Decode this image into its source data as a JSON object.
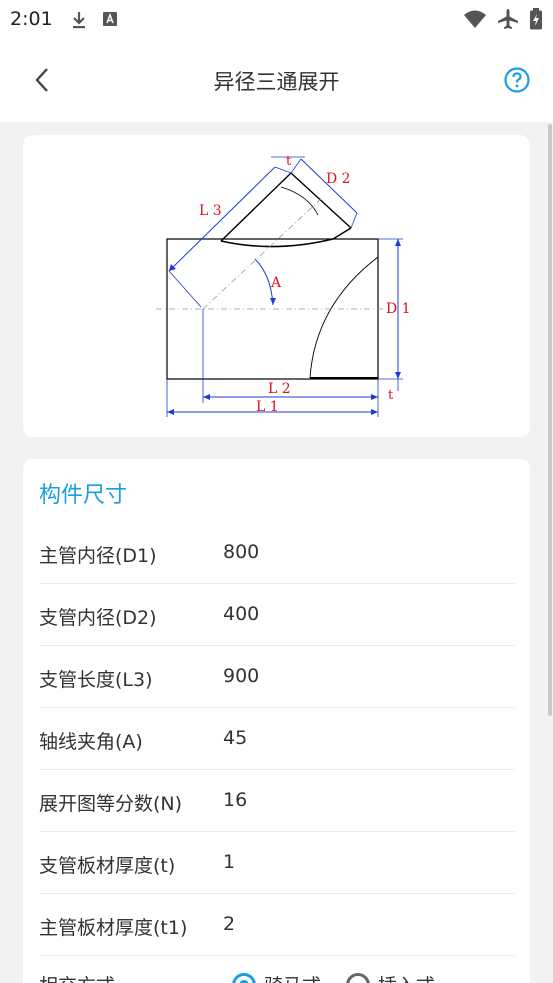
{
  "status_bar": {
    "time": "2:01",
    "icons": [
      "download-icon",
      "font-icon",
      "wifi-icon",
      "airplane-icon",
      "battery-charging-icon"
    ]
  },
  "app_bar": {
    "title": "异径三通展开",
    "back_icon": "chevron-left-icon",
    "help_icon": "help-circle-icon",
    "accent_color": "#1a9ee3"
  },
  "diagram": {
    "labels": {
      "t_top": "t",
      "d2": "D 2",
      "l3": "L 3",
      "a": "A",
      "d1": "D 1",
      "l2": "L 2",
      "l1": "L 1",
      "t_bottom": "t"
    }
  },
  "form": {
    "section_title": "构件尺寸",
    "rows": [
      {
        "label": "主管内径(D1)",
        "value": "800"
      },
      {
        "label": "支管内径(D2)",
        "value": "400"
      },
      {
        "label": "支管长度(L3)",
        "value": "900"
      },
      {
        "label": "轴线夹角(A)",
        "value": "45"
      },
      {
        "label": "展开图等分数(N)",
        "value": "16"
      },
      {
        "label": "支管板材厚度(t)",
        "value": "1"
      },
      {
        "label": "主管板材厚度(t1)",
        "value": "2"
      }
    ],
    "radio": {
      "label": "相交方式",
      "options": [
        {
          "label": "骑马式",
          "selected": true
        },
        {
          "label": "插入式",
          "selected": false
        }
      ]
    }
  }
}
